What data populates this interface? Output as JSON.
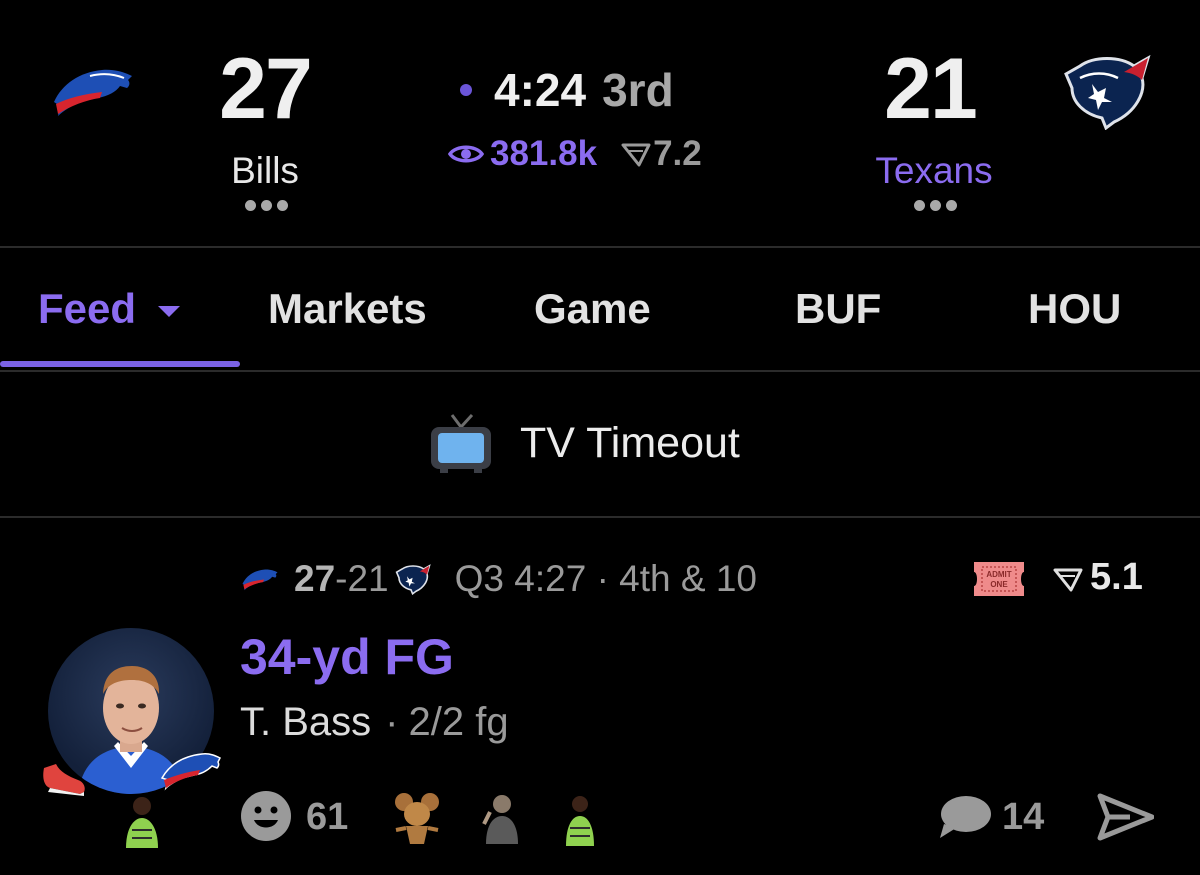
{
  "colors": {
    "background": "#000000",
    "accent": "#8b6cf0",
    "muted": "#9a9a9a",
    "divider": "#2b2b2b"
  },
  "scoreboard": {
    "home": {
      "score": "27",
      "name": "Bills",
      "logo": "bills-logo"
    },
    "away": {
      "score": "21",
      "name": "Texans",
      "logo": "texans-logo"
    },
    "clock": "4:24",
    "period": "3rd",
    "viewers": "381.8k",
    "rating": "7.2",
    "icons": [
      "live-dot",
      "eye-icon",
      "wedge-icon",
      "more-dots-icon"
    ]
  },
  "tabs": [
    {
      "label": "Feed",
      "active": true,
      "has_dropdown": true
    },
    {
      "label": "Markets",
      "active": false
    },
    {
      "label": "Game",
      "active": false
    },
    {
      "label": "BUF",
      "active": false
    },
    {
      "label": "HOU",
      "active": false
    }
  ],
  "timeout": {
    "icon": "tv-icon",
    "text": "TV Timeout"
  },
  "card": {
    "score_home": "27",
    "dash": "-",
    "score_away": "21",
    "situation": "Q3 4:27 · 4th & 10",
    "odds": "5.1",
    "ticket_icon": "admit-one-ticket-icon",
    "ticket_line1": "ADMIT",
    "ticket_line2": "ONE",
    "title": "34-yd FG",
    "player_name": "T. Bass",
    "separator": "·",
    "player_stat": "2/2 fg",
    "reactions_count": "61",
    "comments_count": "14",
    "icons": [
      "smile-icon",
      "comment-icon",
      "share-icon",
      "shoe-icon",
      "player-avatar"
    ]
  }
}
